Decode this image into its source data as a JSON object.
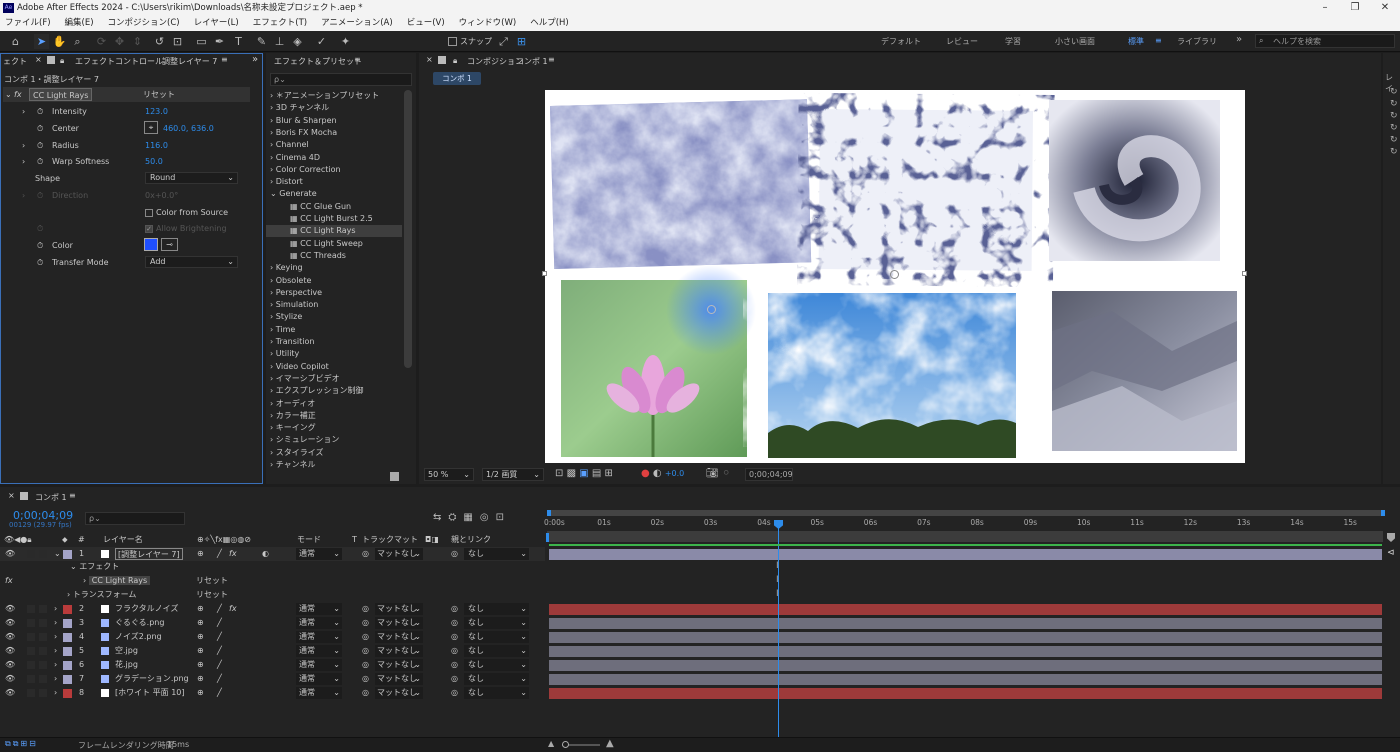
{
  "app": {
    "title": "Adobe After Effects 2024 - C:\\Users\\rikim\\Downloads\\名称未設定プロジェクト.aep *",
    "logo": "Ae"
  },
  "menu": [
    "ファイル(F)",
    "編集(E)",
    "コンポジション(C)",
    "レイヤー(L)",
    "エフェクト(T)",
    "アニメーション(A)",
    "ビュー(V)",
    "ウィンドウ(W)",
    "ヘルプ(H)"
  ],
  "toolbar": {
    "snap_label": "スナップ",
    "workspaces": [
      "デフォルト",
      "レビュー",
      "学習",
      "小さい画面",
      "標準",
      "ライブラリ"
    ],
    "help_placeholder": "ヘルプを検索"
  },
  "effect_controls": {
    "left_tab": "ェクト",
    "tab_label": "エフェクトコントロール",
    "tab_layer": "調整レイヤー 7",
    "breadcrumb": "コンポ 1・調整レイヤー 7",
    "effect_name": "CC Light Rays",
    "reset": "リセット",
    "params": [
      {
        "name": "Intensity",
        "value": "123.0"
      },
      {
        "name": "Center",
        "value": "460.0, 636.0"
      },
      {
        "name": "Radius",
        "value": "116.0"
      },
      {
        "name": "Warp Softness",
        "value": "50.0"
      }
    ],
    "shape_label": "Shape",
    "shape_value": "Round",
    "direction_label": "Direction",
    "direction_value": "0x+0.0°",
    "color_from_source": "Color from Source",
    "allow_brightening": "Allow Brightening",
    "color_label": "Color",
    "color_value": "#1f4fff",
    "transfer_label": "Transfer Mode",
    "transfer_value": "Add"
  },
  "effects_presets": {
    "tab": "エフェクト＆プリセット",
    "search_placeholder": "ρ⌄",
    "items": [
      "＊アニメーションプリセット",
      "3D チャンネル",
      "Blur & Sharpen",
      "Boris FX Mocha",
      "Channel",
      "Cinema 4D",
      "Color Correction",
      "Distort",
      "Generate",
      "CC Glue Gun",
      "CC Light Burst 2.5",
      "CC Light Rays",
      "CC Light Sweep",
      "CC Threads",
      "Keying",
      "Obsolete",
      "Perspective",
      "Simulation",
      "Stylize",
      "Time",
      "Transition",
      "Utility",
      "Video Copilot",
      "イマーシブビデオ",
      "エクスプレッション制御",
      "オーディオ",
      "カラー補正",
      "キーイング",
      "シミュレーション",
      "スタイライズ",
      "チャンネル"
    ]
  },
  "composition": {
    "tab_label": "コンポジション",
    "tab_name": "コンポ 1",
    "subtab": "コンポ 1",
    "zoom": "50 %",
    "resolution": "1/2 画質",
    "exposure": "+0.0",
    "timecode": "0;00;04;09"
  },
  "timeline": {
    "tab": "コンポ 1",
    "timecode": "0;00;04;09",
    "fps": "00129 (29.97 fps)",
    "col_layer": "レイヤー名",
    "col_mode": "モード",
    "col_track": "トラックマット",
    "col_parent": "親とリンク",
    "effects_label": "エフェクト",
    "effect_name": "CC Light Rays",
    "transform_label": "トランスフォーム",
    "reset": "リセット",
    "ticks": [
      "0:00s",
      "01s",
      "02s",
      "03s",
      "04s",
      "05s",
      "06s",
      "07s",
      "08s",
      "09s",
      "10s",
      "11s",
      "12s",
      "13s",
      "14s",
      "15s"
    ],
    "layers": [
      {
        "num": "1",
        "name": "[調整レイヤー 7]",
        "mode": "通常",
        "matte": "マットなし",
        "parent": "なし",
        "color": "#a4a4c8"
      },
      {
        "num": "2",
        "name": "フラクタルノイズ",
        "mode": "通常",
        "matte": "マットなし",
        "parent": "なし",
        "color": "#b93b3b"
      },
      {
        "num": "3",
        "name": "ぐるぐる.png",
        "mode": "通常",
        "matte": "マットなし",
        "parent": "なし",
        "color": "#a4a4c8"
      },
      {
        "num": "4",
        "name": "ノイズ2.png",
        "mode": "通常",
        "matte": "マットなし",
        "parent": "なし",
        "color": "#a4a4c8"
      },
      {
        "num": "5",
        "name": "空.jpg",
        "mode": "通常",
        "matte": "マットなし",
        "parent": "なし",
        "color": "#a4a4c8"
      },
      {
        "num": "6",
        "name": "花.jpg",
        "mode": "通常",
        "matte": "マットなし",
        "parent": "なし",
        "color": "#a4a4c8"
      },
      {
        "num": "7",
        "name": "グラデーション.png",
        "mode": "通常",
        "matte": "マットなし",
        "parent": "なし",
        "color": "#a4a4c8"
      },
      {
        "num": "8",
        "name": "[ホワイト 平面 10]",
        "mode": "通常",
        "matte": "マットなし",
        "parent": "なし",
        "color": "#b93b3b"
      }
    ]
  },
  "status": {
    "render_label": "フレームレンダリング時間",
    "render_time": "15ms"
  }
}
